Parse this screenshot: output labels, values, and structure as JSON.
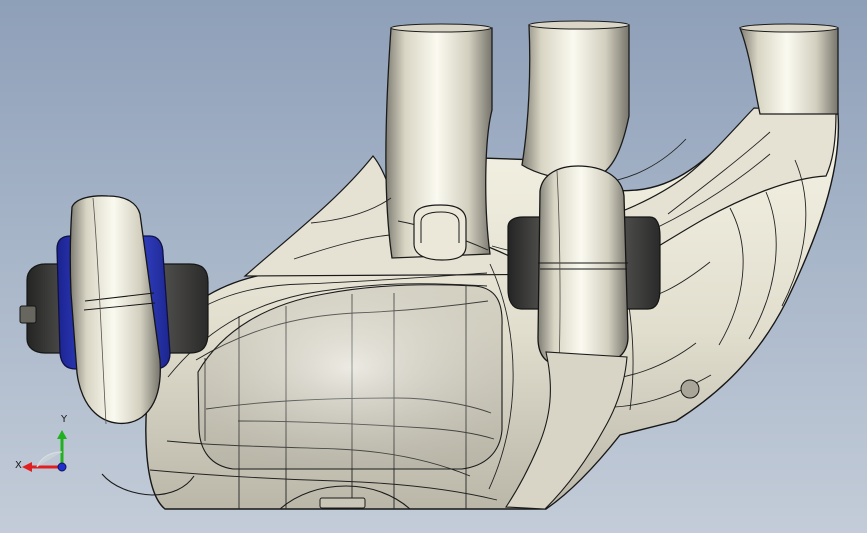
{
  "viewport": {
    "background_top": "#8e9fb8",
    "background_bottom": "#c3ccd8"
  },
  "colors": {
    "metal_light": "#f7f5e8",
    "metal_mid": "#d8d5c5",
    "metal_dark": "#8f8d82",
    "edge": "#1f1f1f",
    "bushing_blue": "#3346c9",
    "bushing_dark": "#55544d"
  },
  "orientation_triad": {
    "x_label": "X",
    "y_label": "Y",
    "x_color": "#e02020",
    "y_color": "#20b020",
    "z_color": "#2030d0"
  }
}
